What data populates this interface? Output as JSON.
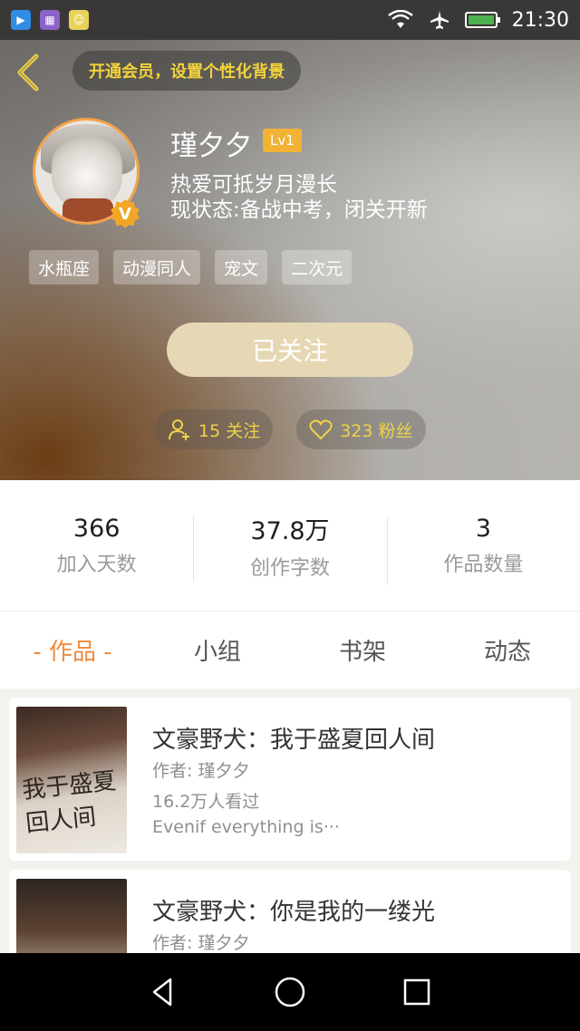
{
  "status_bar": {
    "time": "21:30",
    "app_icons": [
      "video-app-icon",
      "gallery-app-icon",
      "wechat-app-icon"
    ],
    "wifi": "wifi-icon",
    "airplane": "airplane-icon",
    "battery": "battery-charging-icon",
    "battery_color": "#4caf50"
  },
  "header": {
    "back_icon": "chevron-left-icon",
    "vip_prompt": "开通会员，设置个性化背景",
    "accent_color": "#f3d23c"
  },
  "profile": {
    "username": "瑾夕夕",
    "level": "Lv1",
    "verified_badge": "V",
    "bio_line1": "热爱可抵岁月漫长",
    "bio_line2": "现状态:备战中考，闭关开新",
    "tags": [
      "水瓶座",
      "动漫同人",
      "宠文",
      "二次元"
    ],
    "follow_state": "已关注",
    "following": "15 关注",
    "fans": "323 粉丝"
  },
  "stats": [
    {
      "value": "366",
      "label": "加入天数"
    },
    {
      "value": "37.8万",
      "label": "创作字数"
    },
    {
      "value": "3",
      "label": "作品数量"
    }
  ],
  "tabs": [
    {
      "label": "- 作品 -",
      "active": true
    },
    {
      "label": "小组",
      "active": false
    },
    {
      "label": "书架",
      "active": false
    },
    {
      "label": "动态",
      "active": false
    }
  ],
  "works": [
    {
      "title": "文豪野犬：我于盛夏回人间",
      "author": "作者: 瑾夕夕",
      "views": "16.2万人看过",
      "desc": "Evenif everything is···",
      "cover_text": "我于盛夏回人间"
    },
    {
      "title": "文豪野犬：你是我的一缕光",
      "author": "作者: 瑾夕夕",
      "views": "",
      "desc": "",
      "cover_text": ""
    }
  ],
  "nav": {
    "back": "back-triangle-icon",
    "home": "home-circle-icon",
    "recents": "recents-square-icon"
  }
}
